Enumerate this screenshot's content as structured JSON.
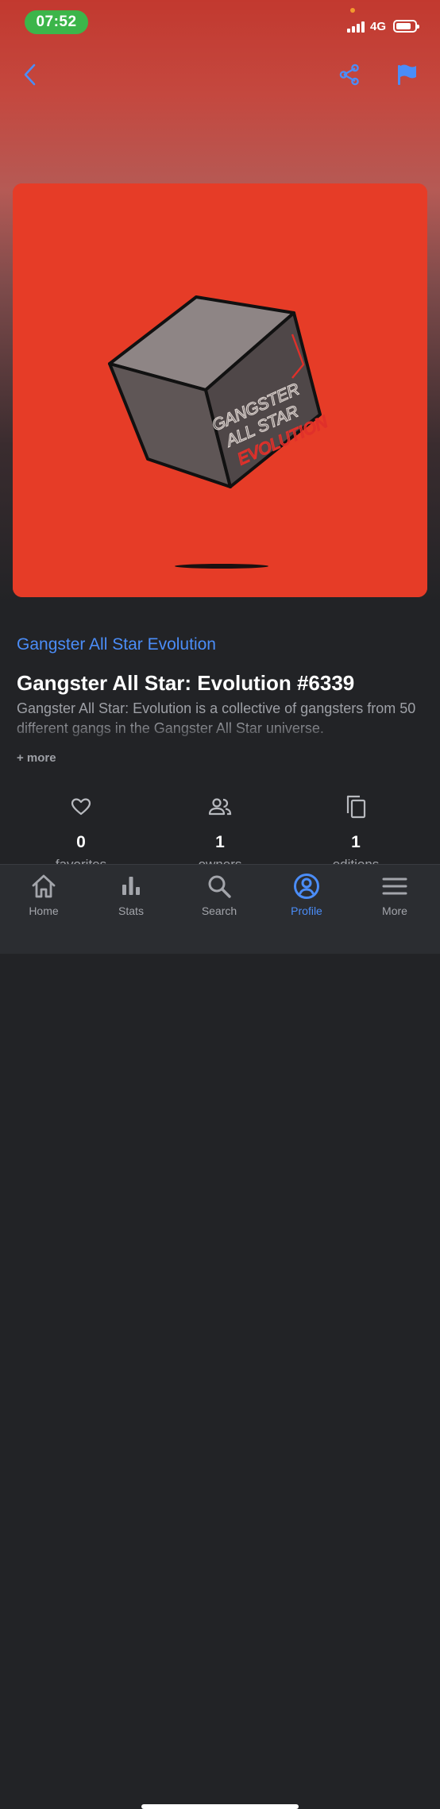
{
  "status_bar": {
    "time": "07:52",
    "network": "4G"
  },
  "nft": {
    "artwork_text_line1": "GANGSTER",
    "artwork_text_line2": "ALL STAR",
    "artwork_text_line3": "EVOLUTION",
    "collection": "Gangster All Star Evolution",
    "title": "Gangster All Star: Evolution #6339",
    "description": "Gangster All Star: Evolution is a collective of gangsters from 50 different gangs in the Gangster All Star universe.",
    "more_label": "+ more"
  },
  "stats": [
    {
      "icon": "heart-icon",
      "value": "0",
      "label": "favorites"
    },
    {
      "icon": "people-icon",
      "value": "1",
      "label": "owners"
    },
    {
      "icon": "copy-icon",
      "value": "1",
      "label": "editions"
    }
  ],
  "tabs": [
    {
      "label": "Home",
      "icon": "home-icon",
      "active": false
    },
    {
      "label": "Stats",
      "icon": "stats-icon",
      "active": false
    },
    {
      "label": "Search",
      "icon": "search-icon",
      "active": false
    },
    {
      "label": "Profile",
      "icon": "profile-icon",
      "active": true
    },
    {
      "label": "More",
      "icon": "menu-icon",
      "active": false
    }
  ],
  "colors": {
    "accent": "#4b8df8",
    "artwork_background": "#e63c27",
    "time_pill": "#3cb54a",
    "page_background": "#222326"
  }
}
